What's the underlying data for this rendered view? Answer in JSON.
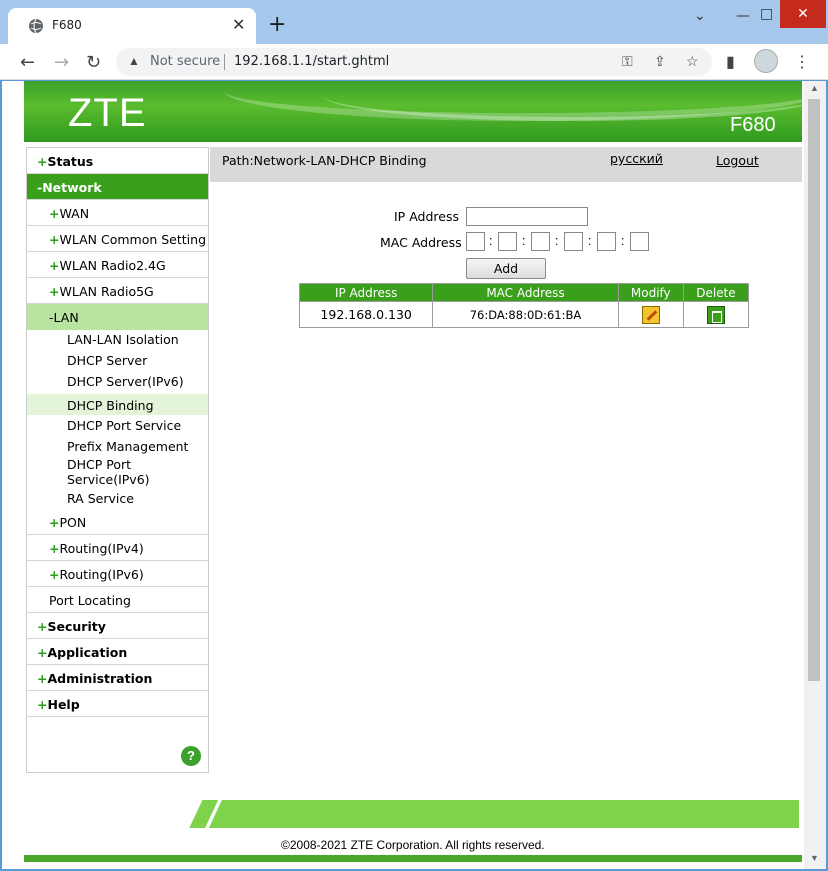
{
  "browser": {
    "tab_title": "F680",
    "not_secure": "Not secure",
    "url": "192.168.1.1/start.ghtml"
  },
  "header": {
    "logo": "ZTE",
    "model": "F680"
  },
  "topbar": {
    "path": "Path:Network-LAN-DHCP Binding",
    "language": "русский",
    "logout": "Logout"
  },
  "menu": {
    "status": "Status",
    "network": "-Network",
    "wan": "WAN",
    "wlan_common": "WLAN Common Setting",
    "wlan_24": "WLAN Radio2.4G",
    "wlan_5g": "WLAN Radio5G",
    "lan": "-LAN",
    "lan_items": [
      "LAN-LAN Isolation",
      "DHCP Server",
      "DHCP Server(IPv6)",
      "DHCP Binding",
      "DHCP Port Service",
      "Prefix Management",
      "DHCP Port Service(IPv6)",
      "RA Service"
    ],
    "pon": "PON",
    "routing4": "Routing(IPv4)",
    "routing6": "Routing(IPv6)",
    "port_locating": "Port Locating",
    "security": "Security",
    "application": "Application",
    "administration": "Administration",
    "help": "Help",
    "help_icon": "?"
  },
  "form": {
    "ip_label": "IP Address",
    "mac_label": "MAC Address",
    "colon": ":",
    "add_label": "Add"
  },
  "table": {
    "headers": [
      "IP Address",
      "MAC Address",
      "Modify",
      "Delete"
    ],
    "rows": [
      {
        "ip": "192.168.0.130",
        "mac": "76:DA:88:0D:61:BA"
      }
    ]
  },
  "footer": {
    "copyright": "©2008-2021 ZTE Corporation. All rights reserved."
  },
  "colors": {
    "accent": "#3a9f1b",
    "lan_highlight": "#b8e3a1",
    "footer_bar": "#7ed34b"
  }
}
